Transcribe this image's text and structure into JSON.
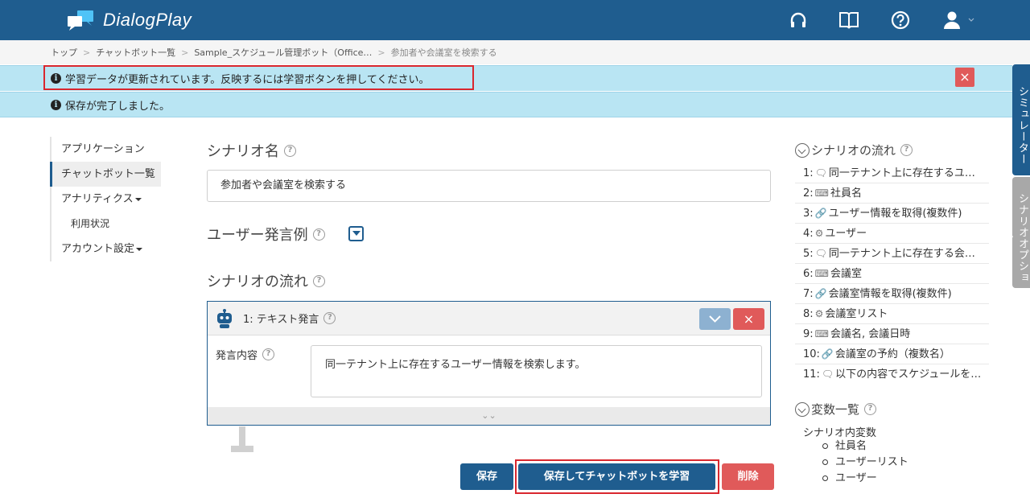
{
  "app": {
    "name": "DialogPlay"
  },
  "breadcrumb": [
    "トップ",
    "チャットボット一覧",
    "Sample_スケジュール管理ボット（Office…",
    "参加者や会議室を検索する"
  ],
  "alerts": {
    "training": "学習データが更新されています。反映するには学習ボタンを押してください。",
    "saved": "保存が完了しました。",
    "close_symbol": "×"
  },
  "side_tabs": {
    "simulator": "シミュレーター",
    "options": "シナリオオプション"
  },
  "nav": {
    "items": [
      {
        "label": "アプリケーション"
      },
      {
        "label": "チャットボット一覧"
      },
      {
        "label": "アナリティクス"
      },
      {
        "label": "利用状況"
      },
      {
        "label": "アカウント設定"
      }
    ]
  },
  "main": {
    "scenario_name_label": "シナリオ名",
    "scenario_name_value": "参加者や会議室を検索する",
    "user_examples_label": "ユーザー発言例",
    "flow_label": "シナリオの流れ",
    "help_symbol": "?",
    "card": {
      "title": "1: テキスト発言",
      "field_label": "発言内容",
      "field_value": "同一テナント上に存在するユーザー情報を検索します。",
      "close_symbol": "×",
      "expand_symbol": "⌄⌄"
    },
    "buttons": {
      "save": "保存",
      "save_and_learn": "保存してチャットボットを学習",
      "delete": "削除"
    }
  },
  "right_panel": {
    "flow_title": "シナリオの流れ",
    "flow_items": [
      {
        "num": "1:",
        "icon": "speech-bubble",
        "glyph": "🗨",
        "text": "同一テナント上に存在するユ…"
      },
      {
        "num": "2:",
        "icon": "keyboard",
        "glyph": "⌨",
        "text": "社員名"
      },
      {
        "num": "3:",
        "icon": "link",
        "glyph": "🔗",
        "text": "ユーザー情報を取得(複数件)"
      },
      {
        "num": "4:",
        "icon": "gear",
        "glyph": "⚙",
        "text": "ユーザー"
      },
      {
        "num": "5:",
        "icon": "speech-bubble",
        "glyph": "🗨",
        "text": "同一テナント上に存在する会…"
      },
      {
        "num": "6:",
        "icon": "keyboard",
        "glyph": "⌨",
        "text": "会議室"
      },
      {
        "num": "7:",
        "icon": "link",
        "glyph": "🔗",
        "text": "会議室情報を取得(複数件)"
      },
      {
        "num": "8:",
        "icon": "gear",
        "glyph": "⚙",
        "text": "会議室リスト"
      },
      {
        "num": "9:",
        "icon": "keyboard",
        "glyph": "⌨",
        "text": "会議名, 会議日時"
      },
      {
        "num": "10:",
        "icon": "link",
        "glyph": "🔗",
        "text": "会議室の予約（複数名）"
      },
      {
        "num": "11:",
        "icon": "speech-bubble",
        "glyph": "🗨",
        "text": "以下の内容でスケジュールを…"
      }
    ],
    "vars_title": "変数一覧",
    "vars_subheading": "シナリオ内変数",
    "vars": [
      "社員名",
      "ユーザーリスト",
      "ユーザー"
    ]
  },
  "colors": {
    "primary": "#1f5d8f",
    "danger": "#e05a5a",
    "alert_bg": "#b9e5f3",
    "highlight": "#d9272e"
  }
}
